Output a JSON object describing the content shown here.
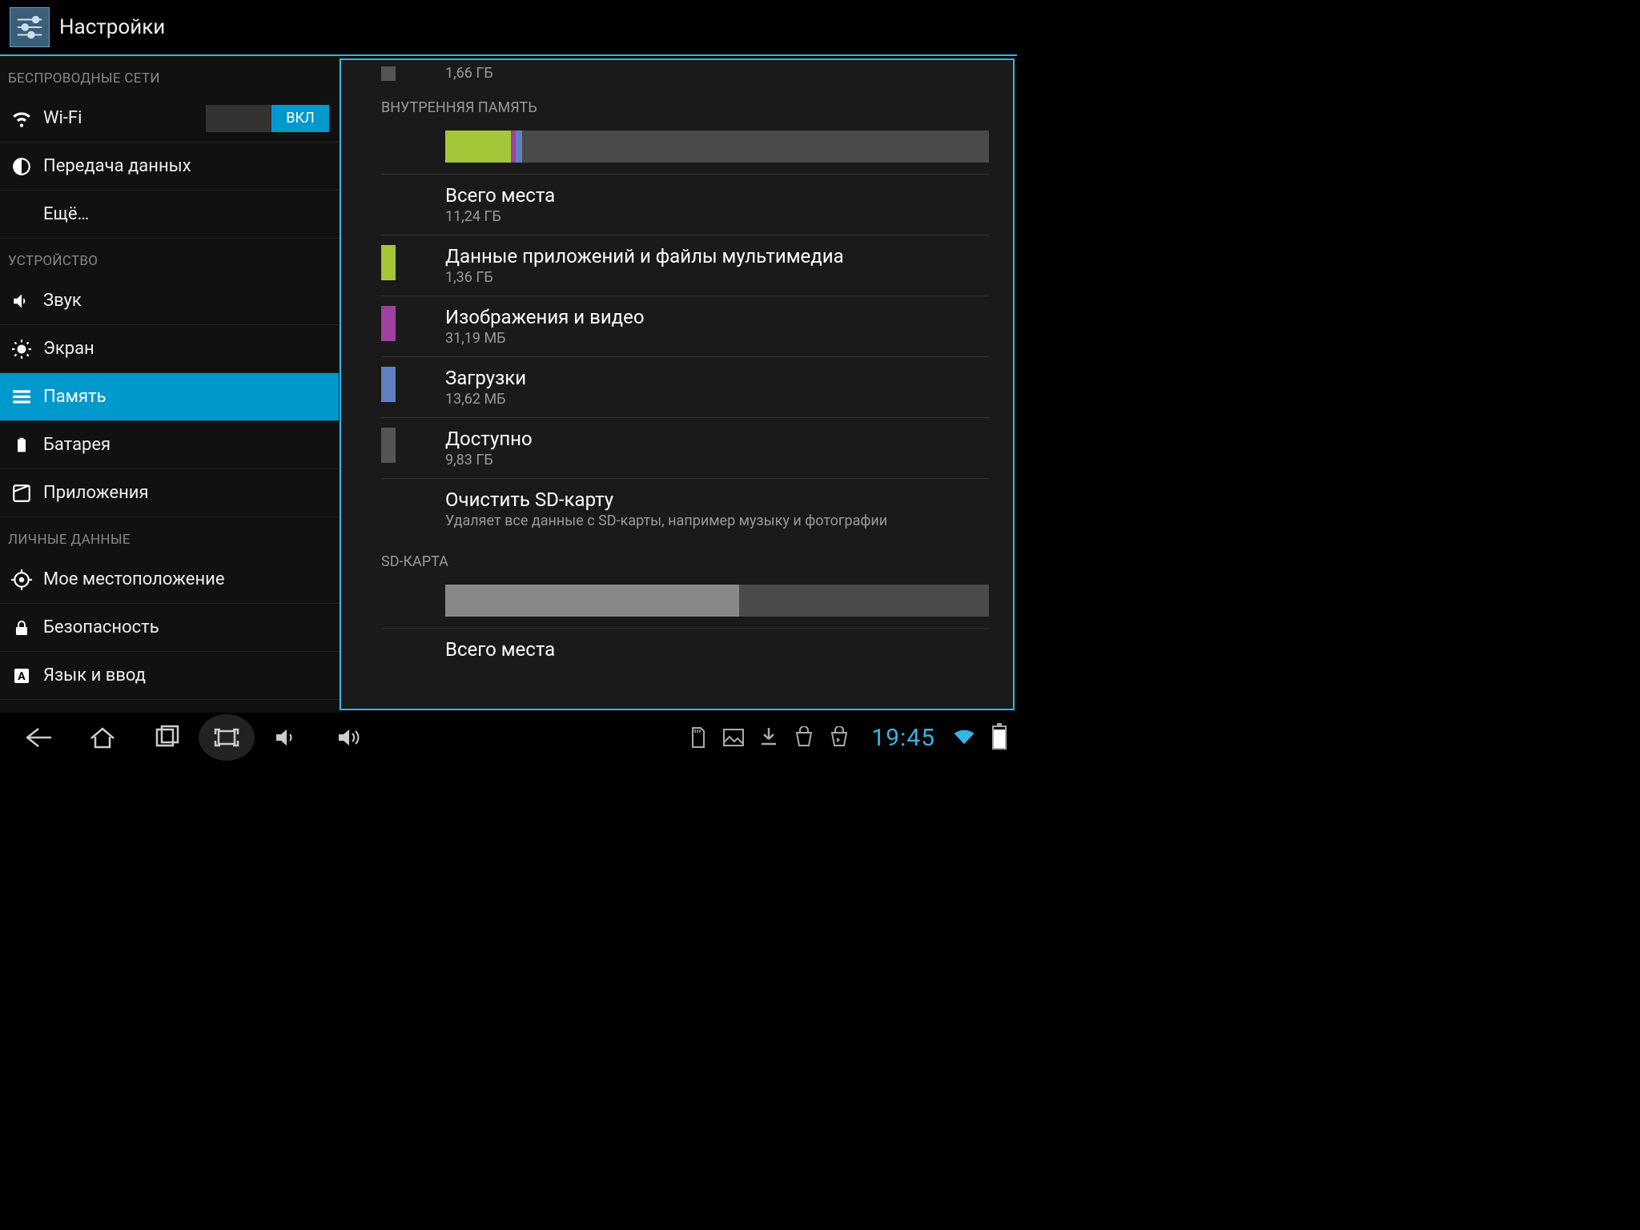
{
  "actionbar": {
    "title": "Настройки"
  },
  "sidebar": {
    "section_wireless": "БЕСПРОВОДНЫЕ СЕТИ",
    "section_device": "УСТРОЙСТВО",
    "section_personal": "ЛИЧНЫЕ ДАННЫЕ",
    "wifi": "Wi‑Fi",
    "wifi_switch": "ВКЛ",
    "data": "Передача данных",
    "more": "Ещё…",
    "sound": "Звук",
    "display": "Экран",
    "memory": "Память",
    "battery": "Батарея",
    "apps": "Приложения",
    "location": "Мое местоположение",
    "security": "Безопасность",
    "language": "Язык и ввод"
  },
  "content": {
    "top_value": "1,66 ГБ",
    "internal_title": "ВНУТРЕННЯЯ ПАМЯТЬ",
    "segments": [
      {
        "color": "#a4c639",
        "pct": 12.1
      },
      {
        "color": "#a040a0",
        "pct": 0.8
      },
      {
        "color": "#6080c0",
        "pct": 1.3
      }
    ],
    "rows": [
      {
        "swatch": null,
        "label": "Всего места",
        "value": "11,24 ГБ"
      },
      {
        "swatch": "#a4c639",
        "label": "Данные приложений и файлы мультимедиа",
        "value": "1,36 ГБ"
      },
      {
        "swatch": "#a040a0",
        "label": "Изображения и видео",
        "value": "31,19 МБ"
      },
      {
        "swatch": "#6080c0",
        "label": "Загрузки",
        "value": "13,62 МБ"
      },
      {
        "swatch": "#555555",
        "label": "Доступно",
        "value": "9,83 ГБ"
      },
      {
        "swatch": null,
        "label": "Очистить SD-карту",
        "value": "Удаляет все данные с SD-карты, например музыку и фотографии"
      }
    ],
    "sd_title": "SD-КАРТА",
    "sd_used_pct": 54,
    "sd_rows": [
      {
        "label": "Всего места"
      }
    ]
  },
  "navbar": {
    "clock": "19:45"
  }
}
